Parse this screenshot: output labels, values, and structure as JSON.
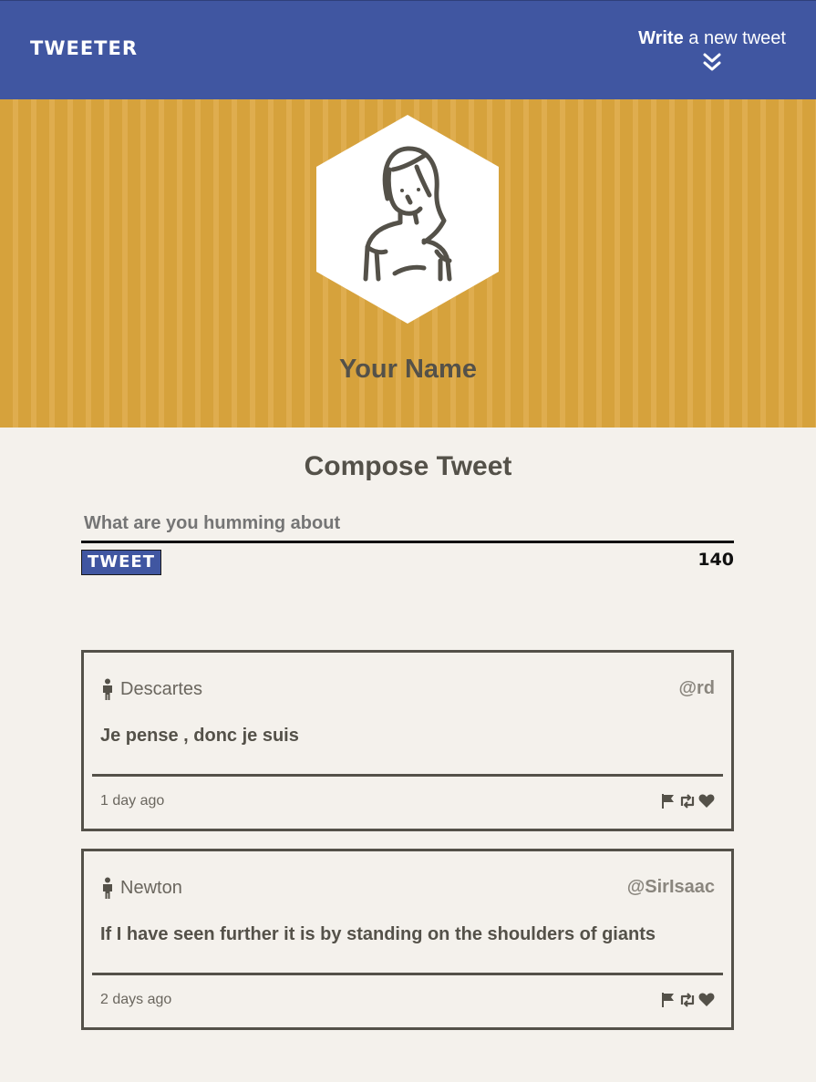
{
  "nav": {
    "brand": "TWEETER",
    "write_bold": "Write",
    "write_rest": " a new tweet",
    "chevron_icon": "chevron-double-down-icon"
  },
  "header": {
    "avatar_icon": "avatar-woman-icon",
    "name": "Your Name"
  },
  "compose": {
    "title": "Compose Tweet",
    "placeholder": "What are you humming about",
    "button_label": "TWEET",
    "counter": "140"
  },
  "tweets": [
    {
      "author": "Descartes",
      "handle": "@rd",
      "content": "Je pense , donc je suis",
      "time": "1 day ago"
    },
    {
      "author": "Newton",
      "handle": "@SirIsaac",
      "content": "If I have seen further it is by standing on the shoulders of giants",
      "time": "2 days ago"
    }
  ],
  "colors": {
    "nav": "#4056a1",
    "header": "#d6a23c",
    "background": "#f4f1ec",
    "text": "#545149"
  }
}
